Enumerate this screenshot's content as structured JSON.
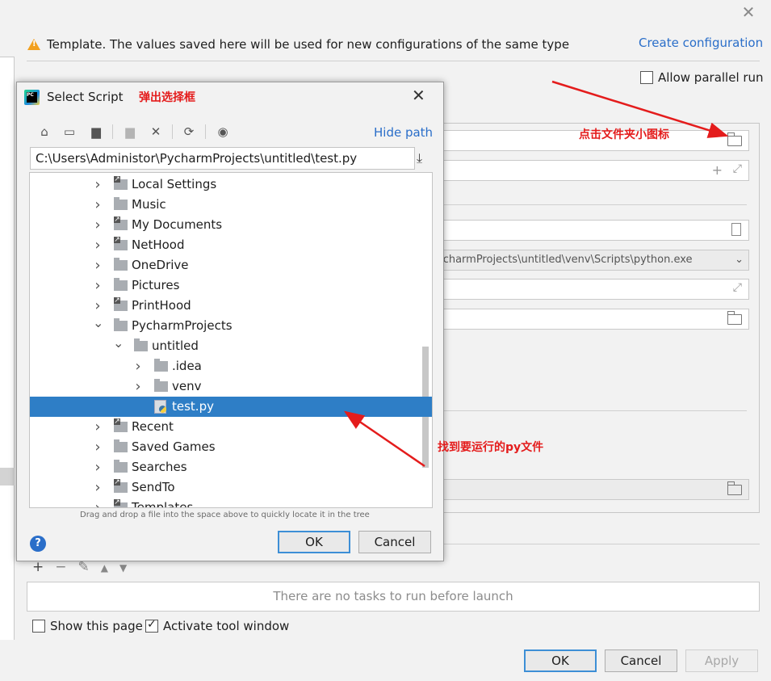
{
  "colors": {
    "accent": "#2a6ec9",
    "selection": "#2e7ec6",
    "annotation": "#e41c1c",
    "warning": "#f2a01e"
  },
  "settings": {
    "warning_text": "Template. The values saved here will be used for new configurations of the same type",
    "create_link": "Create configuration",
    "allow_parallel_label": "Allow parallel run",
    "allow_parallel_checked": false,
    "interpreter_value": "ycharmProjects\\untitled\\venv\\Scripts\\python.exe",
    "no_tasks_text": "There are no tasks to run before launch",
    "task_tools": [
      "+",
      "−",
      "✎",
      "▲",
      "▼"
    ],
    "show_page_label": "Show this page",
    "show_page_checked": false,
    "activate_tool_label": "Activate tool window",
    "activate_tool_checked": true,
    "buttons": {
      "ok": "OK",
      "cancel": "Cancel",
      "apply": "Apply"
    }
  },
  "dialog": {
    "title": "Select Script",
    "hide_path": "Hide path",
    "path": "C:\\Users\\Administor\\PycharmProjects\\untitled\\test.py",
    "toolbar_icons": [
      "home-icon",
      "desktop-icon",
      "project-icon",
      "new-folder-icon",
      "delete-icon",
      "refresh-icon",
      "show-hidden-icon"
    ],
    "tree": [
      {
        "label": "Local Settings",
        "depth": 0,
        "expanded": false,
        "type": "link-folder"
      },
      {
        "label": "Music",
        "depth": 0,
        "expanded": false,
        "type": "folder"
      },
      {
        "label": "My Documents",
        "depth": 0,
        "expanded": false,
        "type": "link-folder"
      },
      {
        "label": "NetHood",
        "depth": 0,
        "expanded": false,
        "type": "link-folder"
      },
      {
        "label": "OneDrive",
        "depth": 0,
        "expanded": false,
        "type": "folder"
      },
      {
        "label": "Pictures",
        "depth": 0,
        "expanded": false,
        "type": "folder"
      },
      {
        "label": "PrintHood",
        "depth": 0,
        "expanded": false,
        "type": "link-folder"
      },
      {
        "label": "PycharmProjects",
        "depth": 0,
        "expanded": true,
        "type": "folder"
      },
      {
        "label": "untitled",
        "depth": 1,
        "expanded": true,
        "type": "folder"
      },
      {
        "label": ".idea",
        "depth": 2,
        "expanded": false,
        "type": "folder"
      },
      {
        "label": "venv",
        "depth": 2,
        "expanded": false,
        "type": "folder"
      },
      {
        "label": "test.py",
        "depth": 2,
        "expanded": null,
        "type": "python-file",
        "selected": true
      },
      {
        "label": "Recent",
        "depth": 0,
        "expanded": false,
        "type": "link-folder"
      },
      {
        "label": "Saved Games",
        "depth": 0,
        "expanded": false,
        "type": "folder"
      },
      {
        "label": "Searches",
        "depth": 0,
        "expanded": false,
        "type": "folder"
      },
      {
        "label": "SendTo",
        "depth": 0,
        "expanded": false,
        "type": "link-folder"
      },
      {
        "label": "Templates",
        "depth": 0,
        "expanded": false,
        "type": "link-folder"
      }
    ],
    "hint": "Drag and drop a file into the space above to quickly locate it in the tree",
    "ok": "OK",
    "cancel": "Cancel",
    "help": "?"
  },
  "annotations": {
    "dialog_popup": "弹出选择框",
    "click_folder": "点击文件夹小图标",
    "find_file": "找到要运行的py文件"
  }
}
